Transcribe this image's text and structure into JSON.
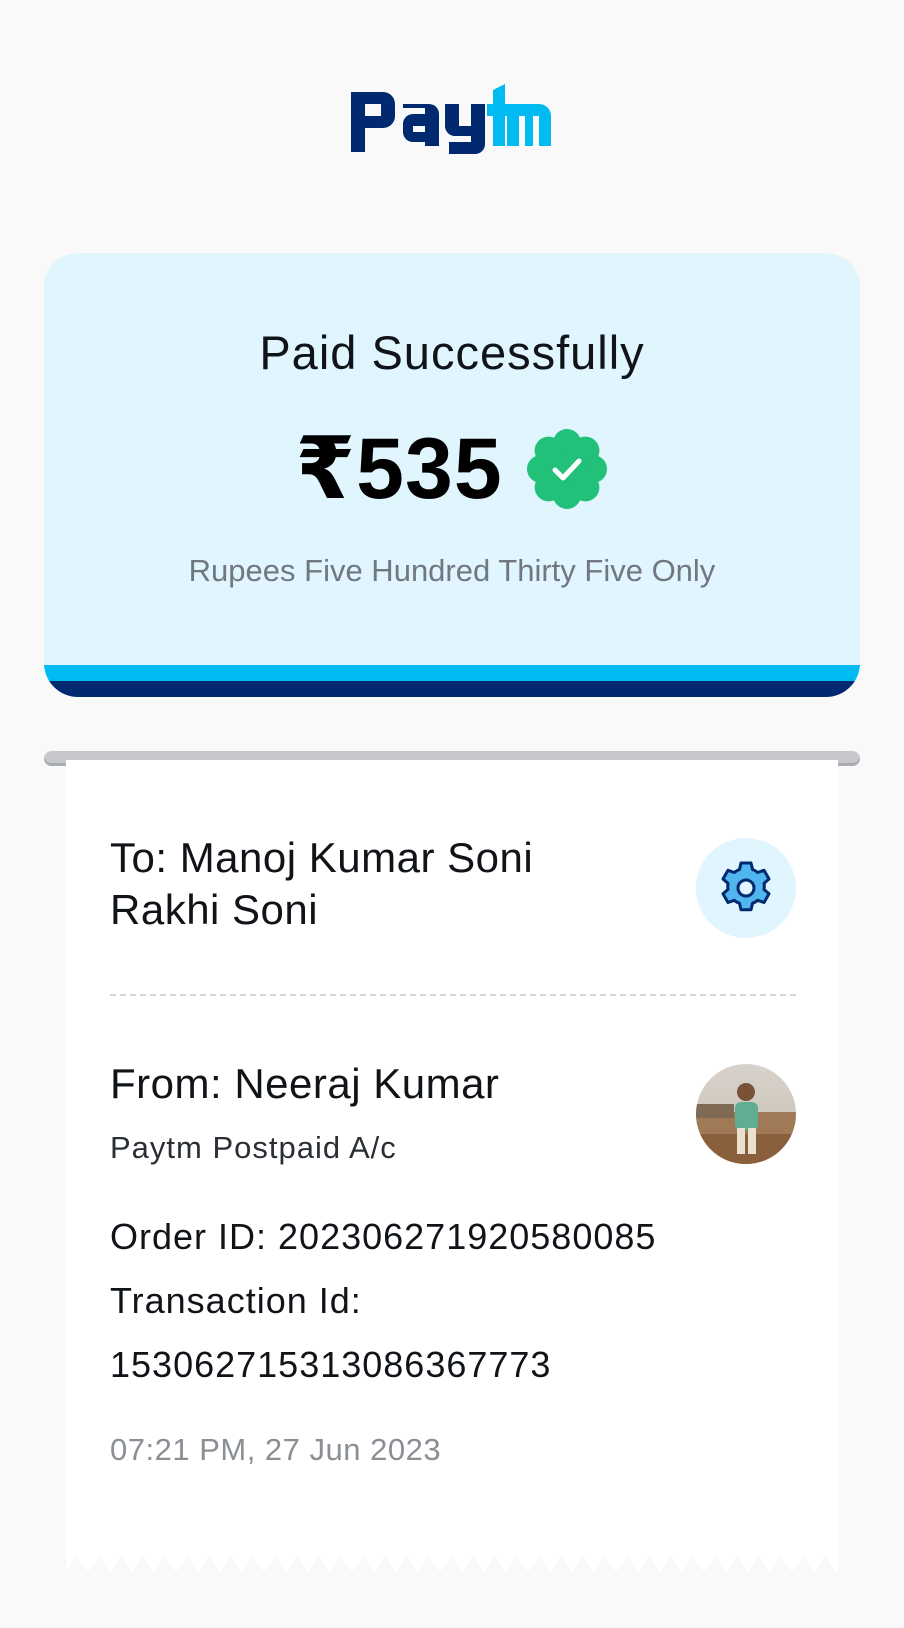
{
  "brand": {
    "logo_text_left": "pay",
    "logo_text_right": "tm",
    "color_dark": "#002970",
    "color_light": "#00baf2"
  },
  "status": {
    "title": "Paid Successfully",
    "amount": "₹535",
    "amount_in_words": "Rupees Five Hundred Thirty Five Only",
    "verified_icon": "verified-check-icon",
    "success_color": "#21c17a"
  },
  "receipt": {
    "to_label": "To: Manoj Kumar Soni",
    "to_name_line2": "Rakhi Soni",
    "settings_icon": "gear-icon",
    "from_label": "From: Neeraj Kumar",
    "from_account": "Paytm Postpaid A/c",
    "order_id": "Order ID: 202306271920580085",
    "transaction_label": "Transaction Id:",
    "transaction_id": "15306271531308636777​3",
    "datetime": "07:21 PM, 27 Jun 2023"
  }
}
